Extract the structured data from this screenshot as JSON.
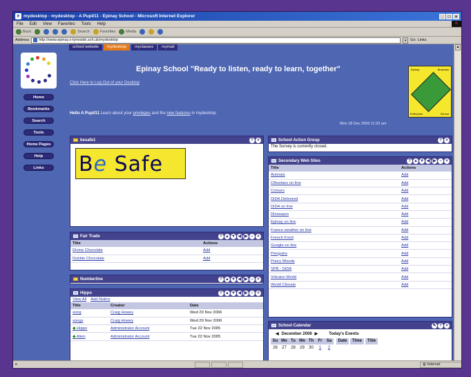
{
  "window": {
    "title": "mydesktop - mydesktop - A Pupil11 - Epinay School - Microsoft Internet Explorer"
  },
  "menu": [
    "File",
    "Edit",
    "View",
    "Favorites",
    "Tools",
    "Help"
  ],
  "toolbar": {
    "back": "Back",
    "search": "Search",
    "favorites": "Favorites",
    "media": "Media"
  },
  "address": {
    "label": "Address",
    "url": "http://www.epinay.s-tyneside.sch.uk/mydesktop",
    "go": "Go",
    "links": "Links"
  },
  "status": {
    "zone": "Internet"
  },
  "topnav": [
    "school website",
    "mydesktop",
    "myclasses",
    "mymail"
  ],
  "topnav_active": 1,
  "leftnav": [
    "Home",
    "Bookmarks",
    "Search",
    "Tools",
    "Home Pages",
    "Help",
    "Links"
  ],
  "banner": {
    "title": "Epinay School \"Ready to listen, ready to learn, together\"",
    "logout": "Click Here to Log Out of your Desktop",
    "hello_name": "Hello A Pupil11",
    "hello_text": "Learn about your",
    "privileges": "privileges",
    "and_the": "and the",
    "new_features": "new features",
    "in_mydesktop": "in mydesktop",
    "date": "Mon 18 Dec 2006 11:33 am",
    "crest": {
      "tl": "Epinay",
      "tr": "Business",
      "bl": "Enterprise",
      "br": "School"
    }
  },
  "bsafe_panel": {
    "title": "besafe1",
    "logo_text_1": "B",
    "logo_text_2": "e",
    "logo_text_3": " Safe"
  },
  "fairtrade": {
    "title": "Fair Trade",
    "headers": [
      "Title",
      "Actions"
    ],
    "rows": [
      [
        "Divine Chocolate",
        "Add"
      ],
      [
        "Dubble Chocolate",
        "Add"
      ]
    ]
  },
  "numberline": {
    "title": "Numberline"
  },
  "hippo": {
    "title": "Hippo",
    "view_all": "View All",
    "add_notice": "Add Notice",
    "headers": [
      "Title",
      "Creator",
      "Date"
    ],
    "rows": [
      [
        "song",
        "Craig Howey",
        "Wed 29 Nov 2006"
      ],
      [
        "songs",
        "Craig Howey",
        "Wed 29 Nov 2006"
      ],
      [
        "Hippo",
        "Administrator Account",
        "Tue 22 Nov 2005"
      ],
      [
        "Alien",
        "Administrator Account",
        "Tue 22 Nov 2005"
      ]
    ]
  },
  "action_group": {
    "title": "School Action Group",
    "text": "The Survey is currently closed."
  },
  "websites": {
    "title": "Secondary Web Sites",
    "headers": [
      "Title",
      "Actions"
    ],
    "rows": [
      [
        "Animals",
        "Add"
      ],
      [
        "CBeebies on line",
        "Add"
      ],
      [
        "Colours",
        "Add"
      ],
      [
        "DiDA Delivered",
        "Add"
      ],
      [
        "DiDA on line",
        "Add"
      ],
      [
        "Dinosaurs",
        "Add"
      ],
      [
        "Epinay on line",
        "Add"
      ],
      [
        "France weather on line",
        "Add"
      ],
      [
        "French Food",
        "Add"
      ],
      [
        "Google on line",
        "Add"
      ],
      [
        "Penguins",
        "Add"
      ],
      [
        "Priory Woods",
        "Add"
      ],
      [
        "SPB - DiDA",
        "Add"
      ],
      [
        "Volcano World",
        "Add"
      ],
      [
        "World Climate",
        "Add"
      ]
    ]
  },
  "calendar": {
    "title": "School Calendar",
    "month": "December 2006",
    "events_title": "Today's Events",
    "days": [
      "Su",
      "Mo",
      "Tu",
      "We",
      "Th",
      "Fr",
      "Sa"
    ],
    "event_headers": [
      "Date",
      "Time",
      "Title"
    ],
    "first_week": [
      "26",
      "27",
      "28",
      "29",
      "30",
      "1",
      "2"
    ]
  },
  "colors": {
    "accent": "#e67a1a",
    "nav": "#2d2b7a",
    "bg": "#4f66b2",
    "panel_head": "#43428c",
    "frame": "#5a3590"
  }
}
